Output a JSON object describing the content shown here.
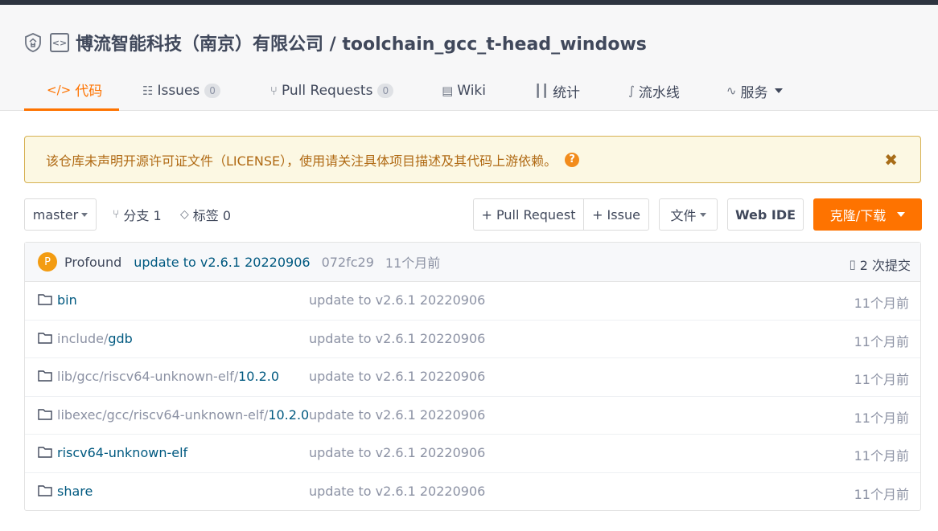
{
  "header": {
    "owner": "博流智能科技（南京）有限公司",
    "separator": " / ",
    "repo": "toolchain_gcc_t-head_windows",
    "tabs": [
      {
        "label": "代码",
        "icon": "code-icon",
        "active": true
      },
      {
        "label": "Issues",
        "icon": "issues-icon",
        "badge": "0"
      },
      {
        "label": "Pull Requests",
        "icon": "pull-request-icon",
        "badge": "0"
      },
      {
        "label": "Wiki",
        "icon": "wiki-icon"
      },
      {
        "label": "统计",
        "icon": "stats-icon"
      },
      {
        "label": "流水线",
        "icon": "pipeline-icon"
      },
      {
        "label": "服务",
        "icon": "pulse-icon",
        "dropdown": true
      }
    ]
  },
  "notice": {
    "text": "该仓库未声明开源许可证文件（LICENSE），使用请关注具体项目描述及其代码上游依赖。",
    "help": "?",
    "close": "✖"
  },
  "toolbar": {
    "branch": "master",
    "branches_label": "分支 1",
    "tags_label": "标签 0",
    "pull_request_btn": "+ Pull Request",
    "issue_btn": "+ Issue",
    "files_btn": "文件",
    "webide_btn": "Web IDE",
    "clone_btn": "克隆/下载"
  },
  "commit": {
    "avatar_letter": "P",
    "author": "Profound",
    "message": "update to v2.6.1 20220906",
    "hash": "072fc29",
    "time": "11个月前",
    "count_label": "2 次提交"
  },
  "files": [
    {
      "prefix": "",
      "name": "bin",
      "message": "update to v2.6.1 20220906",
      "time": "11个月前"
    },
    {
      "prefix": "include/",
      "name": "gdb",
      "message": "update to v2.6.1 20220906",
      "time": "11个月前"
    },
    {
      "prefix": "lib/gcc/riscv64-unknown-elf/",
      "name": "10.2.0",
      "message": "update to v2.6.1 20220906",
      "time": "11个月前"
    },
    {
      "prefix": "libexec/gcc/riscv64-unknown-elf/",
      "name": "10.2.0",
      "message": "update to v2.6.1 20220906",
      "time": "11个月前"
    },
    {
      "prefix": "",
      "name": "riscv64-unknown-elf",
      "message": "update to v2.6.1 20220906",
      "time": "11个月前"
    },
    {
      "prefix": "",
      "name": "share",
      "message": "update to v2.6.1 20220906",
      "time": "11个月前"
    }
  ],
  "colors": {
    "accent": "#fe7300",
    "link": "#005980",
    "notice_bg": "#fcf8e3",
    "notice_text": "#b06a14"
  }
}
